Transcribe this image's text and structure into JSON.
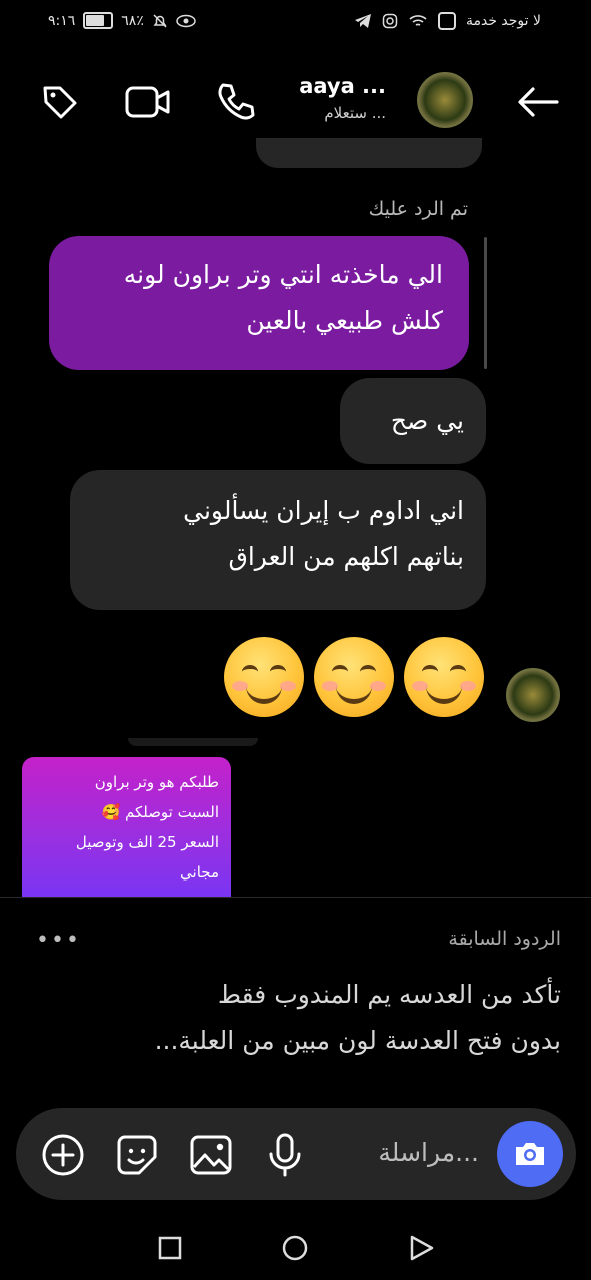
{
  "status_bar": {
    "time": "٩:١٦",
    "battery": "٦٨٪",
    "carrier": "لا توجد خدمة"
  },
  "header": {
    "contact_name": "aaya ...",
    "contact_subtitle": "ستعلام ..."
  },
  "messages": {
    "replied_label": "تم الرد عليك",
    "purple_line1": "الي ماخذته انتي وتر براون لونه",
    "purple_line2": "كلش طبيعي بالعين",
    "gray1": "يي صح",
    "gray2_line1": "اني اداوم ب إيران يسألوني",
    "gray2_line2": "بناتهم اكلهم من العراق",
    "emojis": [
      "😊",
      "😊",
      "😊"
    ]
  },
  "card": {
    "line1": "طلبكم هو وتر براون",
    "line2": "السبت توصلكم 🥰",
    "line3": "السعر  25 الف وتوصيل",
    "line4": "مجاني"
  },
  "previous_replies": {
    "title": "الردود السابقة",
    "menu": "•••",
    "line1": "تأكد من العدسه يم المندوب فقط",
    "line2": "بدون فتح العدسة لون مبين من العلبة..."
  },
  "composer": {
    "placeholder": "مراسلة..."
  }
}
